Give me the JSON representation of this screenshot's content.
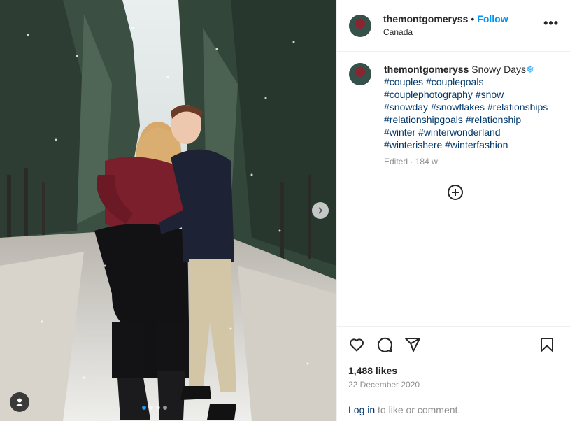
{
  "post": {
    "username": "themontgomeryss",
    "separator": "•",
    "follow_label": "Follow",
    "location": "Canada",
    "more_label": "•••"
  },
  "caption": {
    "username": "themontgomeryss",
    "text": "Snowy Days",
    "emoji": "❄",
    "hashtags": [
      "#couples",
      "#couplegoals",
      "#couplephotography",
      "#snow",
      "#snowday",
      "#snowflakes",
      "#relationships",
      "#relationshipgoals",
      "#relationship",
      "#winter",
      "#winterwonderland",
      "#winterishere",
      "#winterfashion"
    ],
    "edited_text": "Edited",
    "edited_sep": "·",
    "age": "184 w"
  },
  "icons": {
    "like": "heart-icon",
    "comment": "comment-icon",
    "share": "share-icon",
    "save": "bookmark-icon",
    "add": "add-circle-icon",
    "next": "chevron-right-icon",
    "tag": "user-tag-icon"
  },
  "stats": {
    "likes": "1,488 likes",
    "date": "22 December 2020"
  },
  "login": {
    "link_label": "Log in",
    "rest_text": " to like or comment."
  },
  "carousel": {
    "current": 1,
    "total": 4
  },
  "colors": {
    "accent": "#0095f6",
    "hashtag": "#00376b",
    "muted": "#8e8e8e",
    "carousel_active": "#2196f3"
  }
}
